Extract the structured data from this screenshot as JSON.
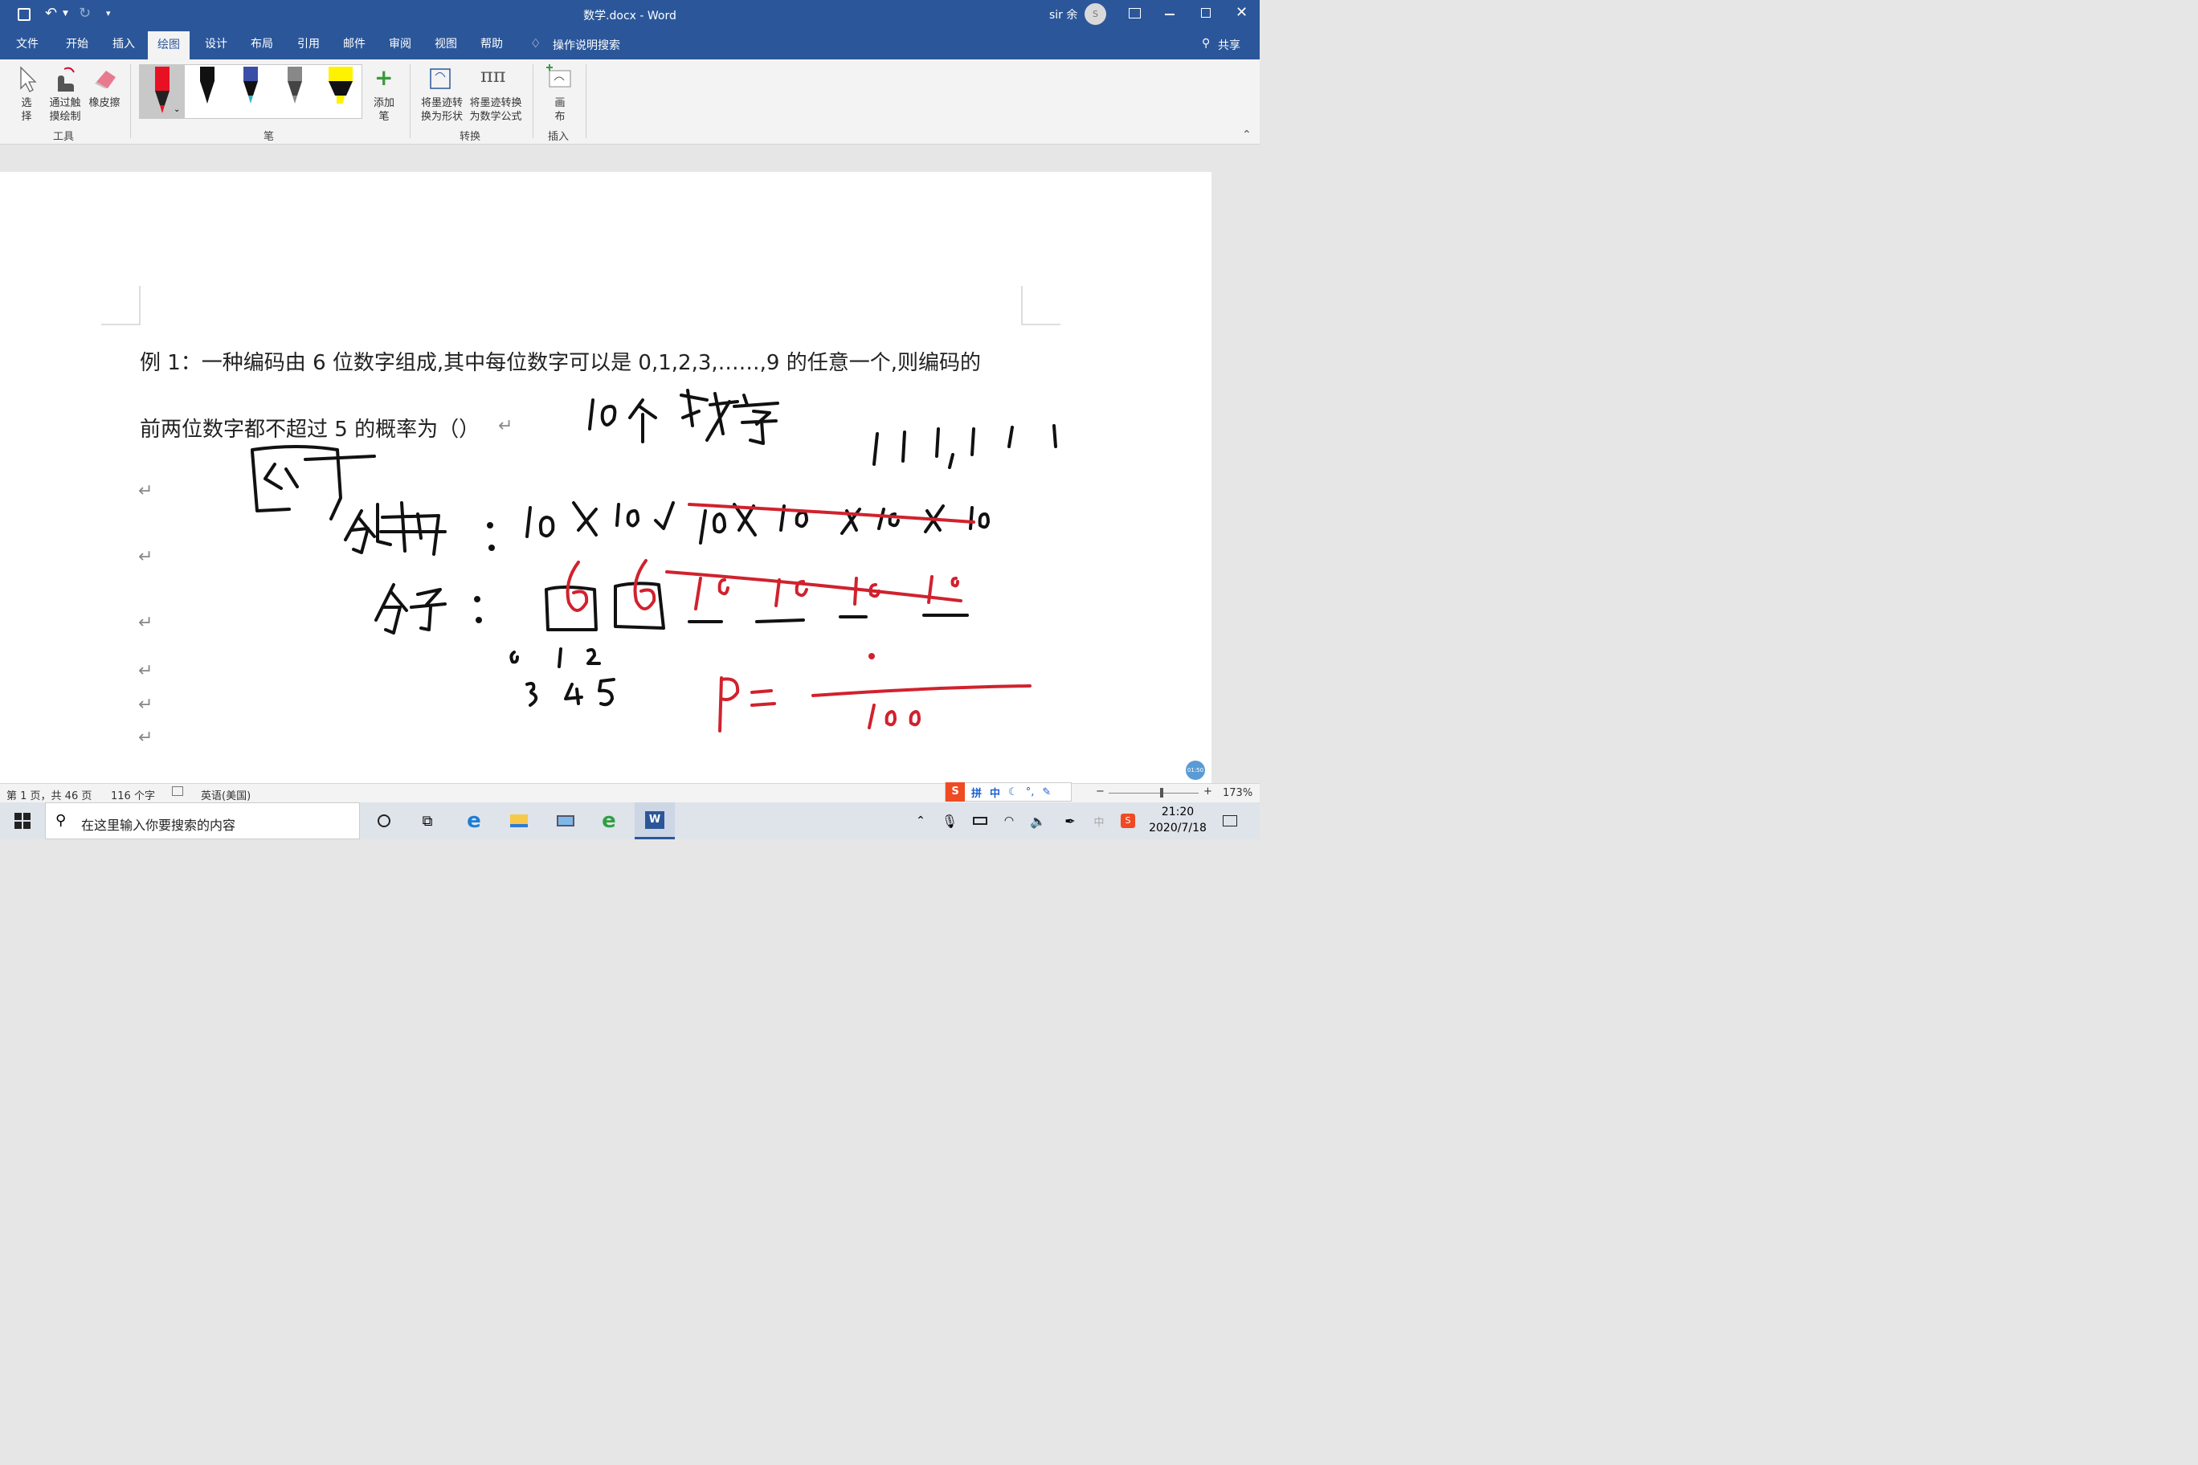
{
  "window": {
    "title": "数学.docx  -  Word",
    "user": "sir 余",
    "avatar_letter": "S"
  },
  "menu": {
    "tabs": [
      "文件",
      "开始",
      "插入",
      "绘图",
      "设计",
      "布局",
      "引用",
      "邮件",
      "审阅",
      "视图",
      "帮助"
    ],
    "active": "绘图",
    "tell_me": "操作说明搜索",
    "share": "共享"
  },
  "ribbon": {
    "tools": {
      "select": "选\n择",
      "touch_draw": "通过触\n摸绘制",
      "eraser": "橡皮擦",
      "group": "工具"
    },
    "pens": {
      "add_pen": "添加\n笔",
      "group": "笔"
    },
    "convert": {
      "to_shape": "将墨迹转\n换为形状",
      "to_math": "将墨迹转换\n为数学公式",
      "group": "转换"
    },
    "insert": {
      "canvas": "画\n布",
      "group": "插入"
    }
  },
  "document": {
    "line1": "例 1：一种编码由 6 位数字组成,其中每位数字可以是 0,1,2,3,……,9 的任意一个,则编码的",
    "line2": "前两位数字都不超过 5 的概率为（）",
    "para_mark": "↵"
  },
  "status": {
    "page": "第 1 页，共 46 页",
    "words": "116 个字",
    "language": "英语(美国)",
    "zoom": "173%"
  },
  "ime": {
    "pinyin": "拼",
    "zhong": "中"
  },
  "taskbar": {
    "search_placeholder": "在这里输入你要搜索的内容",
    "time": "21:20",
    "date": "2020/7/18",
    "ime_indicator": "中"
  },
  "recording": {
    "timer": "01:50"
  },
  "colors": {
    "accent": "#2b579a",
    "ink_red": "#d0222e",
    "ink_black": "#111111"
  }
}
